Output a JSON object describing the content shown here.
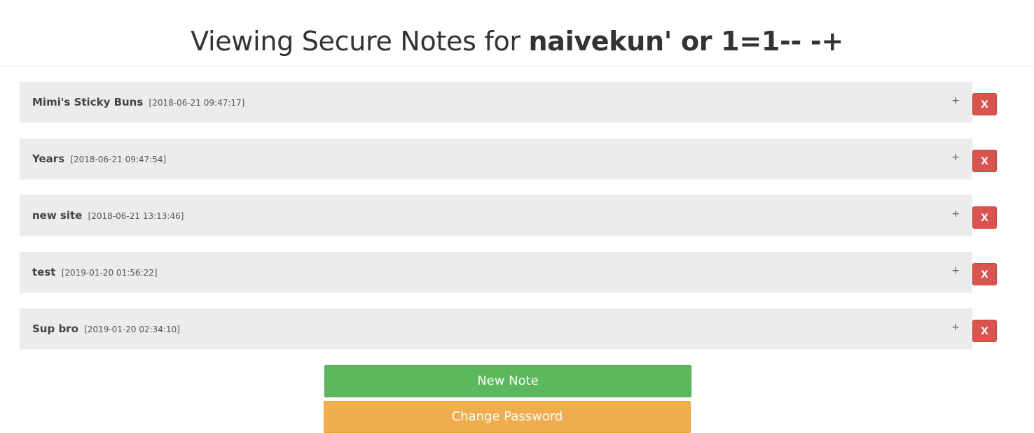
{
  "header": {
    "title_prefix": "Viewing Secure Notes for ",
    "username": "naivekun' or 1=1-- -+"
  },
  "notes": [
    {
      "title": "Mimi's Sticky Buns",
      "date": "[2018-06-21 09:47:17]",
      "expand": "+",
      "delete": "X"
    },
    {
      "title": "Years",
      "date": "[2018-06-21 09:47:54]",
      "expand": "+",
      "delete": "X"
    },
    {
      "title": "new site",
      "date": "[2018-06-21 13:13:46]",
      "expand": "+",
      "delete": "X"
    },
    {
      "title": "test",
      "date": "[2019-01-20 01:56:22]",
      "expand": "+",
      "delete": "X"
    },
    {
      "title": "Sup bro",
      "date": "[2019-01-20 02:34:10]",
      "expand": "+",
      "delete": "X"
    }
  ],
  "actions": {
    "new_note": "New Note",
    "change_password": "Change Password"
  },
  "colors": {
    "success": "#5cb85c",
    "warning": "#f0ad4e",
    "danger": "#d9534f",
    "panel": "#ececec"
  }
}
